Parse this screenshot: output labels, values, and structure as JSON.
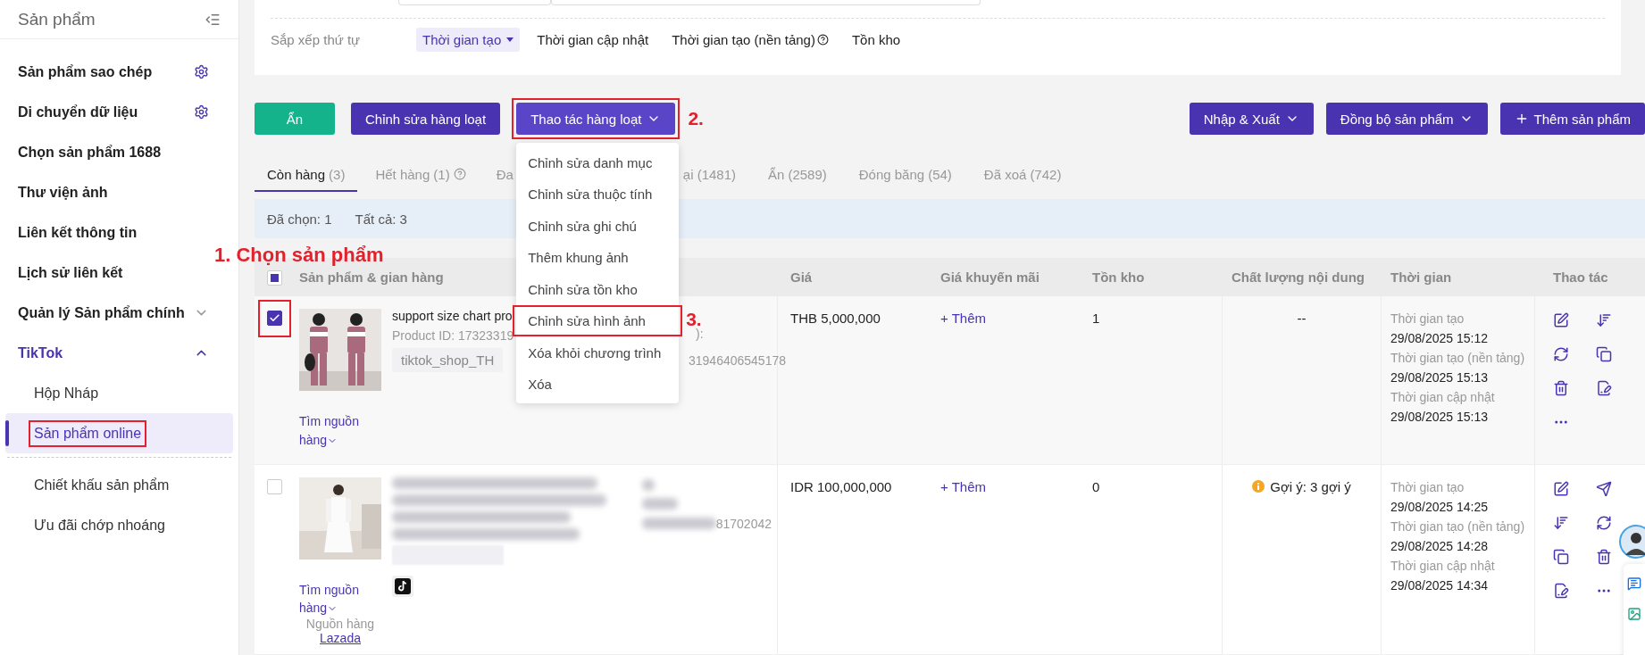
{
  "sidebar": {
    "title": "Sản phẩm",
    "items": [
      {
        "label": "Sản phẩm sao chép",
        "kind": "setting"
      },
      {
        "label": "Di chuyển dữ liệu",
        "kind": "setting"
      },
      {
        "label": "Chọn sản phẩm 1688",
        "kind": "plain"
      },
      {
        "label": "Thư viện ảnh",
        "kind": "plain"
      },
      {
        "label": "Liên kết thông tin",
        "kind": "plain"
      },
      {
        "label": "Lịch sử liên kết",
        "kind": "plain"
      },
      {
        "label": "Quản lý Sản phẩm chính",
        "kind": "group",
        "expanded": false
      },
      {
        "label": "TikTok",
        "kind": "group",
        "expanded": true,
        "children": [
          {
            "label": "Hộp Nháp",
            "selected": false,
            "highlighted": false
          },
          {
            "label": "Sản phẩm online",
            "selected": true,
            "highlighted": true
          }
        ]
      },
      {
        "label": "Chiết khấu sản phẩm",
        "kind": "sub"
      },
      {
        "label": "Ưu đãi chớp nhoáng",
        "kind": "sub"
      }
    ]
  },
  "filter_fields": [
    {
      "kind": "input"
    },
    {
      "kind": "input"
    }
  ],
  "sort": {
    "label": "Sắp xếp thứ tự",
    "options": [
      {
        "label": "Thời gian tạo",
        "selected": true
      },
      {
        "label": "Thời gian cập nhật",
        "selected": false
      },
      {
        "label": "Thời gian tạo (nền tảng)",
        "selected": false,
        "help": true
      },
      {
        "label": "Tồn kho",
        "selected": false
      }
    ]
  },
  "toolbar": {
    "left": [
      {
        "label": "Ẩn",
        "kind": "green"
      },
      {
        "label": "Chỉnh sửa hàng loạt",
        "kind": "primary"
      },
      {
        "label": "Thao tác hàng loạt",
        "kind": "dropdown",
        "expanded": true,
        "highlighted": true,
        "annotation": "2."
      }
    ],
    "right": [
      {
        "label": "Nhập & Xuất",
        "kind": "dropdown"
      },
      {
        "label": "Đồng bộ sản phẩm",
        "kind": "dropdown"
      },
      {
        "label": "Thêm sản phẩm",
        "kind": "add"
      }
    ]
  },
  "menu": {
    "items": [
      {
        "label": "Chỉnh sửa danh mục",
        "highlighted": false
      },
      {
        "label": "Chỉnh sửa thuộc tính",
        "highlighted": false
      },
      {
        "label": "Chỉnh sửa ghi chú",
        "highlighted": false
      },
      {
        "label": "Thêm khung ảnh",
        "highlighted": false
      },
      {
        "label": "Chỉnh sửa tồn kho",
        "highlighted": false
      },
      {
        "label": "Chỉnh sửa hình ảnh",
        "highlighted": true,
        "annotation": "3."
      },
      {
        "label": "Xóa khỏi chương trình",
        "highlighted": false
      },
      {
        "label": "Xóa",
        "highlighted": false
      }
    ]
  },
  "tabs": [
    {
      "label": "Còn hàng",
      "count": "(3)",
      "selected": true
    },
    {
      "label": "Hết hàng",
      "count": "(1)",
      "help": true,
      "selected": false
    },
    {
      "label": "Đa",
      "selected": false
    },
    {
      "label": "ại (1481)",
      "selected": false
    },
    {
      "label": "Ẩn",
      "count": "(2589)",
      "selected": false
    },
    {
      "label": "Đóng băng",
      "count": "(54)",
      "selected": false
    },
    {
      "label": "Đã xoá",
      "count": "(742)",
      "selected": false
    }
  ],
  "selection": {
    "selected": "Đã chọn: 1",
    "total": "Tất cả: 3"
  },
  "table": {
    "annotation": "1. Chọn sản phẩm",
    "indeterminate": true,
    "columns": [
      "Sản phẩm & gian hàng",
      "Giá",
      "Giá khuyến mãi",
      "Tồn kho",
      "Chất lượng nội dung",
      "Thời gian",
      "Thao tác"
    ],
    "rows": [
      {
        "checked": true,
        "highlighted": true,
        "blurred": false,
        "platform_icon": false,
        "name": "support size chart pro",
        "product_id": "Product ID: 17323319",
        "shop": "tiktok_shop_TH",
        "source_link": "Tìm nguồn hàng",
        "sku_lines": [
          "):",
          "31946406545178"
        ],
        "price": "THB 5,000,000",
        "promo": "+ Thêm",
        "stock": "1",
        "quality": {
          "kind": "none",
          "text": "--"
        },
        "times": [
          {
            "label": "Thời gian tạo",
            "value": "29/08/2025 15:12"
          },
          {
            "label": "Thời gian tạo (nền tảng)",
            "value": "29/08/2025 15:13"
          },
          {
            "label": "Thời gian cập nhật",
            "value": "29/08/2025 15:13"
          }
        ],
        "actions": [
          {
            "kind": "edit"
          },
          {
            "kind": "sort"
          },
          {
            "kind": "sync"
          },
          {
            "kind": "copy"
          },
          {
            "kind": "trash"
          },
          {
            "kind": "note"
          },
          {
            "kind": "more"
          }
        ]
      },
      {
        "checked": false,
        "highlighted": false,
        "blurred": true,
        "platform_icon": true,
        "source_link": "Tìm nguồn hàng",
        "source_label": "Nguồn hàng",
        "source_name": "Lazada",
        "sku_lines": [
          "81702042"
        ],
        "price": "IDR 100,000,000",
        "promo": "+ Thêm",
        "stock": "0",
        "quality": {
          "kind": "hint",
          "text": "Gợi ý: 3 gợi ý"
        },
        "times": [
          {
            "label": "Thời gian tạo",
            "value": "29/08/2025 14:25"
          },
          {
            "label": "Thời gian tạo (nền tảng)",
            "value": "29/08/2025 14:28"
          },
          {
            "label": "Thời gian cập nhật",
            "value": "29/08/2025 14:34"
          }
        ],
        "actions": [
          {
            "kind": "edit"
          },
          {
            "kind": "send"
          },
          {
            "kind": "sort"
          },
          {
            "kind": "sync"
          },
          {
            "kind": "copy"
          },
          {
            "kind": "trash"
          },
          {
            "kind": "note"
          },
          {
            "kind": "more"
          }
        ]
      }
    ]
  }
}
